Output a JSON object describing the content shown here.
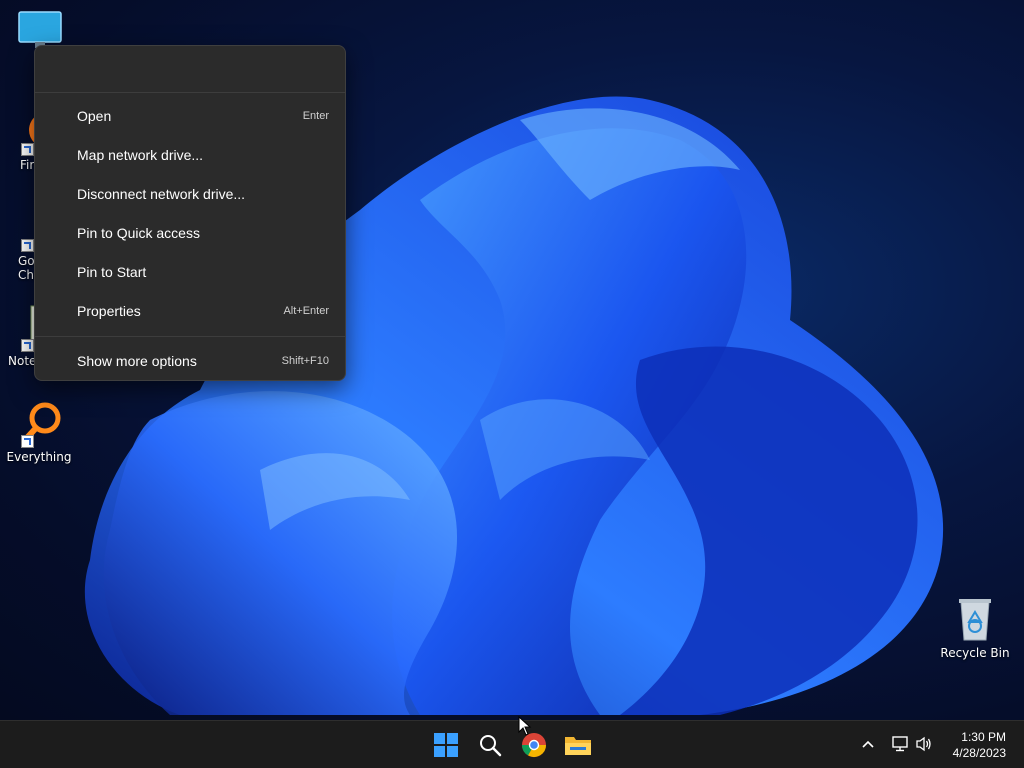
{
  "desktop": {
    "icons": [
      {
        "label": "",
        "icon": "monitor-icon"
      },
      {
        "label": "Fir",
        "icon": "firefox-icon"
      },
      {
        "label": "Go Chr",
        "icon": "chrome-icon"
      },
      {
        "label": "Note",
        "icon": "notepad-icon"
      },
      {
        "label": "Everything",
        "icon": "everything-search-icon"
      },
      {
        "label": "Recycle Bin",
        "icon": "recycle-bin-icon"
      }
    ]
  },
  "context_menu": {
    "items": [
      {
        "label": "Open",
        "accelerator": "Enter"
      },
      {
        "label": "Map network drive...",
        "accelerator": ""
      },
      {
        "label": "Disconnect network drive...",
        "accelerator": ""
      },
      {
        "label": "Pin to Quick access",
        "accelerator": ""
      },
      {
        "label": "Pin to Start",
        "accelerator": ""
      },
      {
        "label": "Properties",
        "accelerator": "Alt+Enter"
      }
    ],
    "more": {
      "label": "Show more options",
      "accelerator": "Shift+F10"
    }
  },
  "taskbar": {
    "apps": [
      "start-icon",
      "search-icon",
      "chrome-icon",
      "file-explorer-icon"
    ],
    "tray": {
      "icons": [
        "chevron-up-icon",
        "network-icon",
        "volume-icon"
      ],
      "time": "1:30 PM",
      "date": "4/28/2023"
    }
  },
  "colors": {
    "menu_bg": "#2b2b2b",
    "taskbar_bg": "#1c1c1c",
    "accent": "#1e6fff"
  }
}
